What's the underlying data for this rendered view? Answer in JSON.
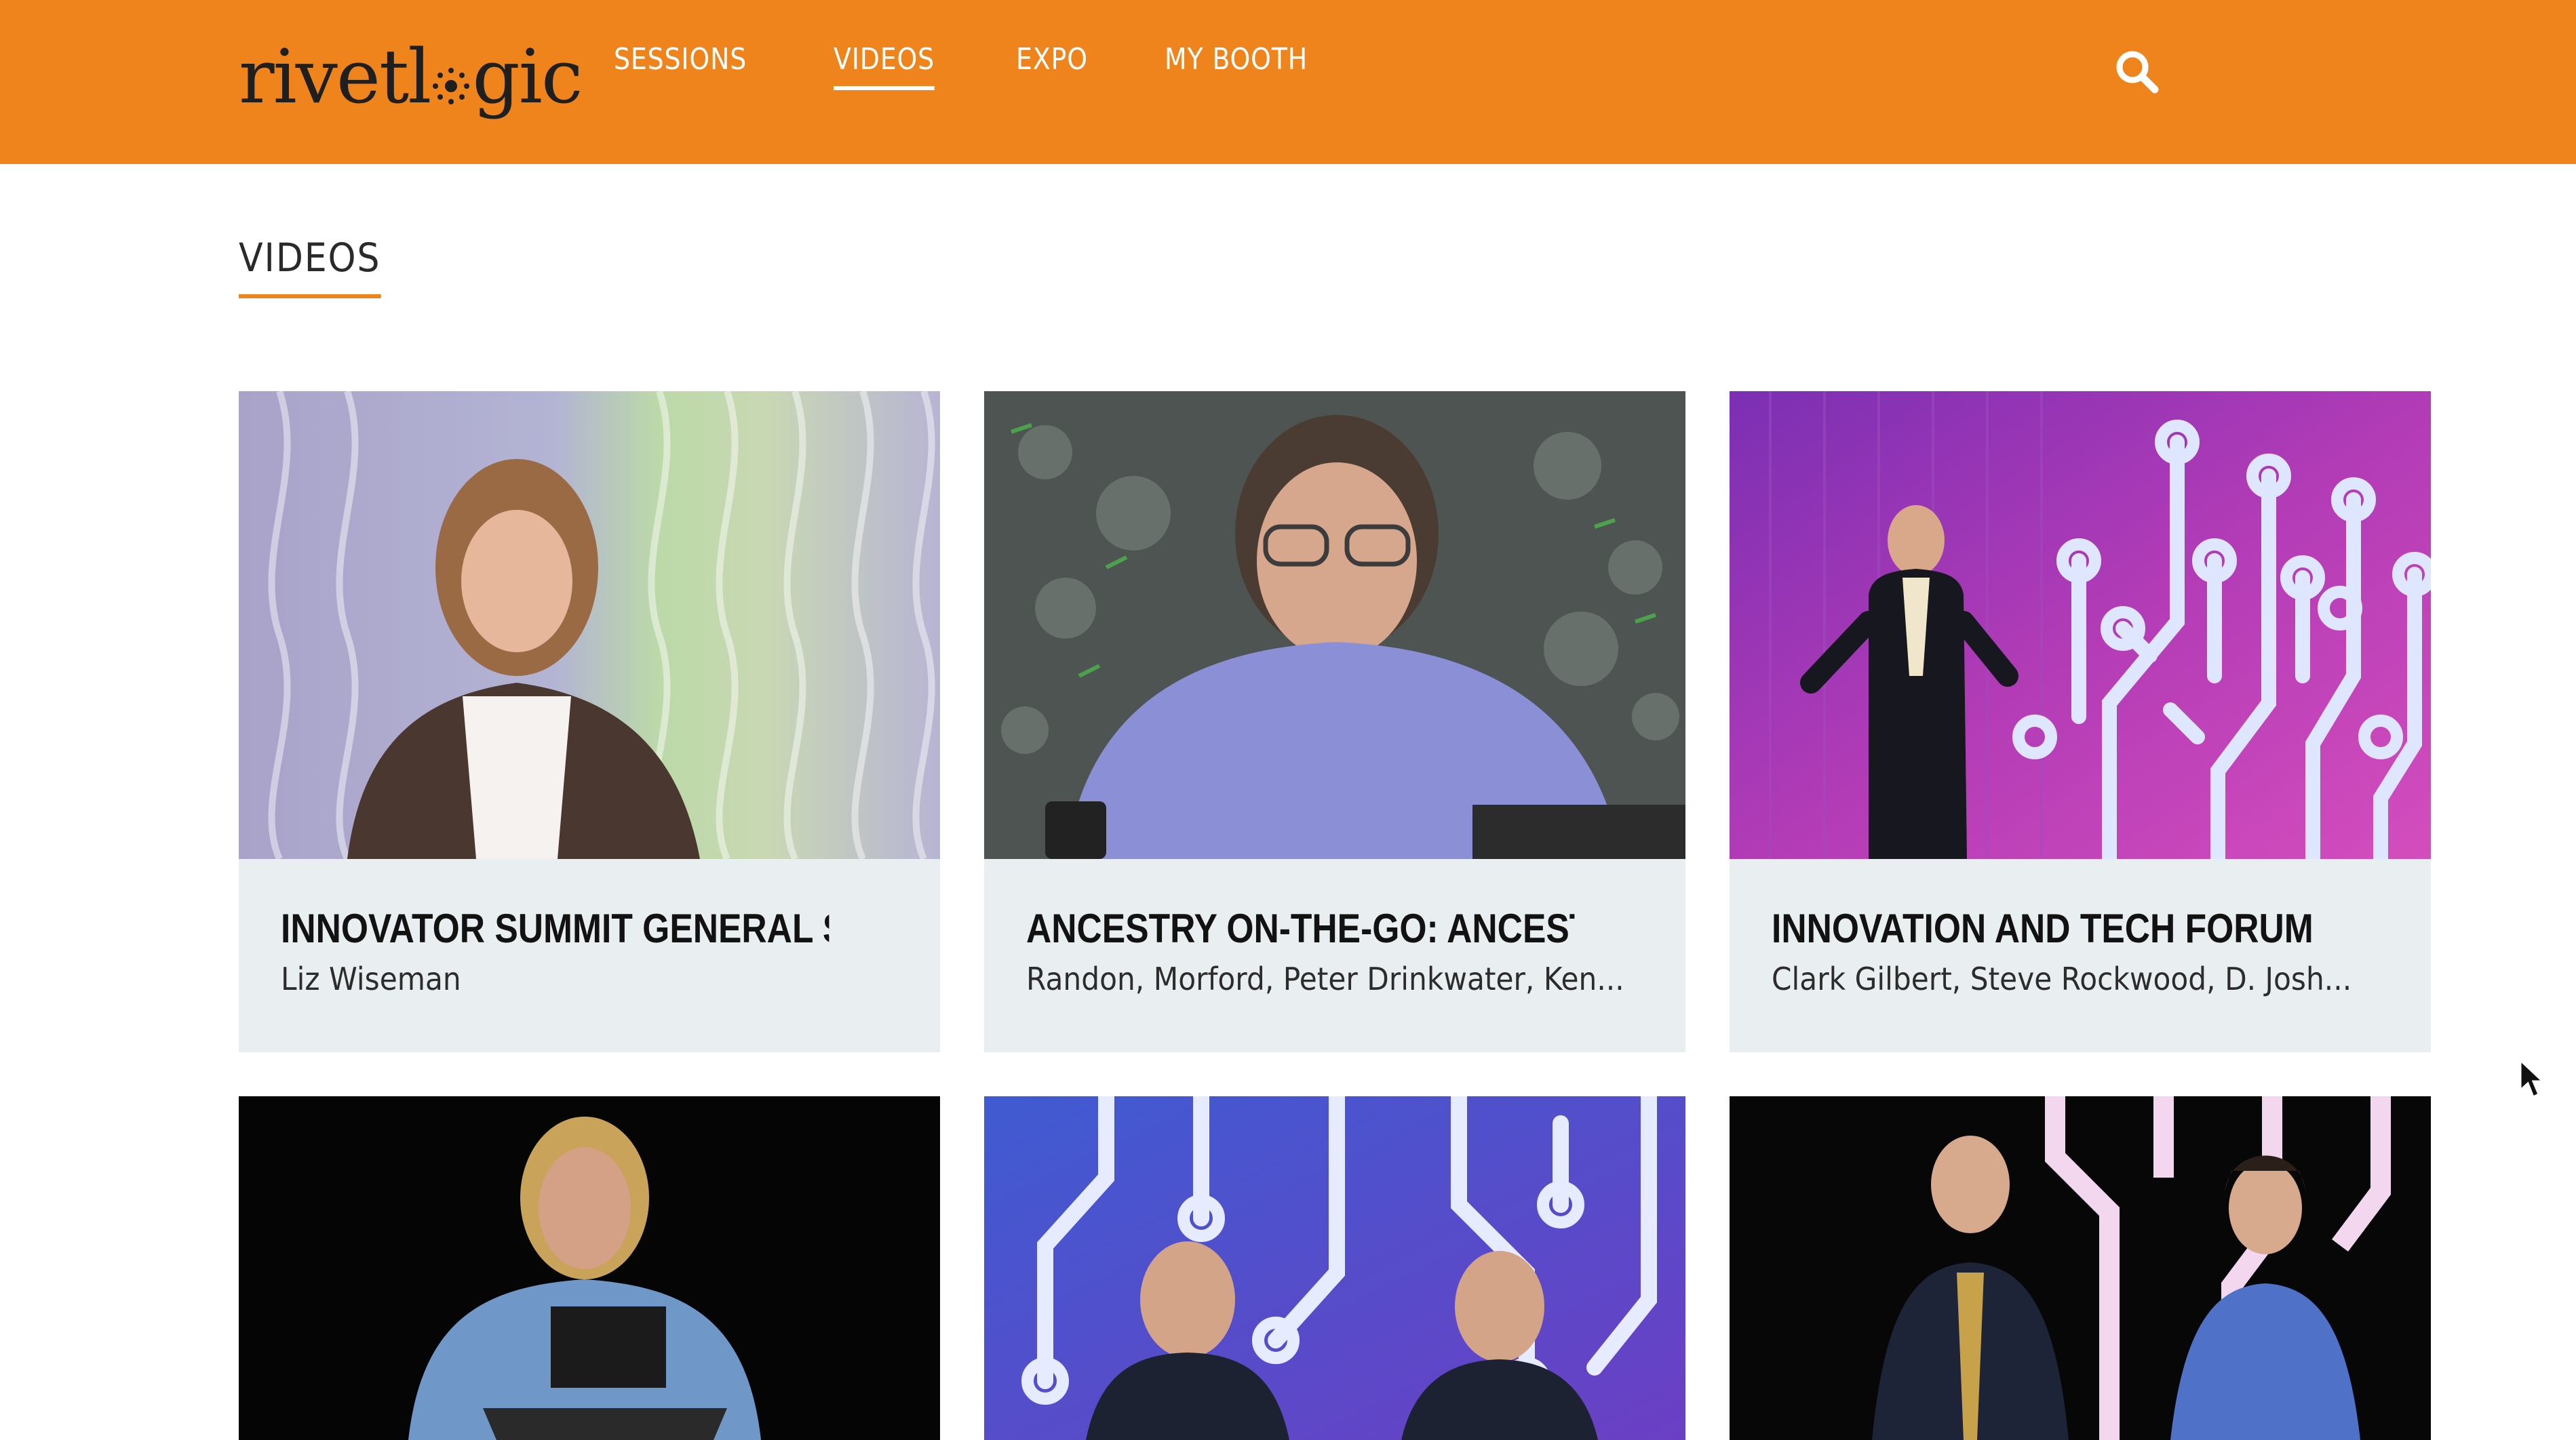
{
  "header": {
    "logo_text_left": "rivetl",
    "logo_text_right": "gic",
    "nav": [
      {
        "label": "SESSIONS",
        "active": false
      },
      {
        "label": "VIDEOS",
        "active": true
      },
      {
        "label": "EXPO",
        "active": false
      },
      {
        "label": "MY BOOTH",
        "active": false
      }
    ],
    "search_icon": "search-icon"
  },
  "main": {
    "title": "VIDEOS"
  },
  "videos": [
    {
      "title": "INNOVATOR SUMMIT GENERAL SESS...",
      "speakers": "Liz Wiseman"
    },
    {
      "title": "ANCESTRY ON-THE-GO: ANCESTRY ...",
      "speakers": "Randon, Morford, Peter Drinkwater, Ken..."
    },
    {
      "title": "INNOVATION AND TECH FORUM",
      "speakers": "Clark Gilbert, Steve Rockwood, D. Josh..."
    },
    {
      "title": "",
      "speakers": ""
    },
    {
      "title": "",
      "speakers": ""
    },
    {
      "title": "",
      "speakers": ""
    }
  ],
  "colors": {
    "brand_orange": "#ef841c",
    "card_bg": "#e9eef0",
    "nav_text": "#ffffff"
  }
}
